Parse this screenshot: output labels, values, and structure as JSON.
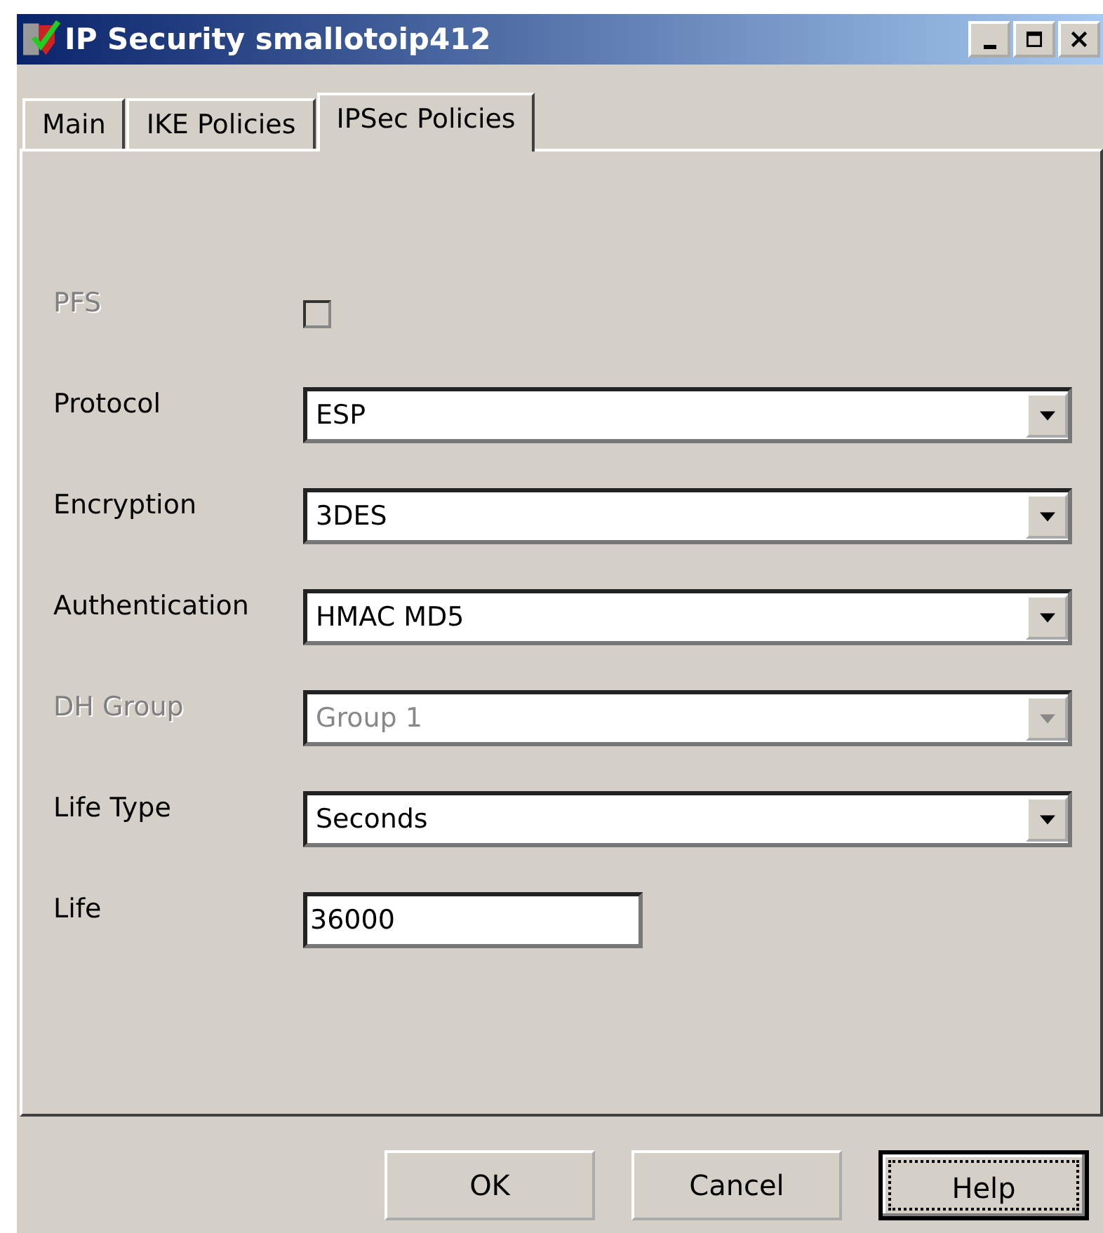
{
  "window": {
    "title": "IP Security smallotoip412"
  },
  "tabs": [
    {
      "label": "Main",
      "selected": false
    },
    {
      "label": "IKE Policies",
      "selected": false
    },
    {
      "label": "IPSec Policies",
      "selected": true
    }
  ],
  "fields": [
    {
      "kind": "checkbox",
      "label": "PFS",
      "checked": false,
      "disabled": true
    },
    {
      "kind": "dropdown",
      "label": "Protocol",
      "value": "ESP",
      "disabled": false
    },
    {
      "kind": "dropdown",
      "label": "Encryption",
      "value": "3DES",
      "disabled": false
    },
    {
      "kind": "dropdown",
      "label": "Authentication",
      "value": "HMAC MD5",
      "disabled": false
    },
    {
      "kind": "dropdown",
      "label": "DH Group",
      "value": "Group 1",
      "disabled": true
    },
    {
      "kind": "dropdown",
      "label": "Life Type",
      "value": "Seconds",
      "disabled": false
    },
    {
      "kind": "text",
      "label": "Life",
      "value": "36000",
      "disabled": false
    }
  ],
  "buttons": [
    {
      "label": "OK",
      "focused": false
    },
    {
      "label": "Cancel",
      "focused": false
    },
    {
      "label": "Help",
      "focused": true
    }
  ]
}
